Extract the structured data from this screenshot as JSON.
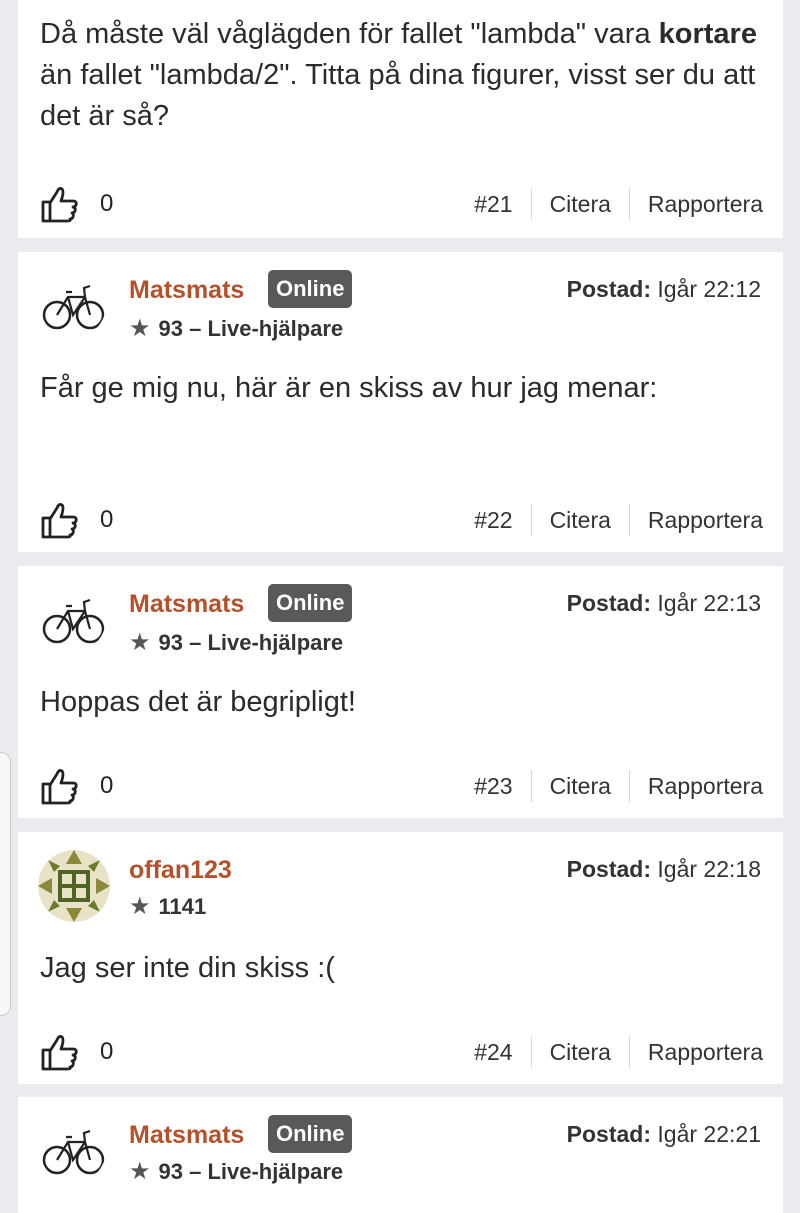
{
  "posts": [
    {
      "body_prefix": "Då måste väl våglägden för fallet \"lambda\" vara ",
      "body_bold": "kortare",
      "body_suffix": " än fallet \"lambda/2\". Titta på dina figurer, visst ser du att det är så?",
      "likes": "0",
      "number": "#21",
      "quote": "Citera",
      "report": "Rapportera"
    },
    {
      "author": "Matsmats",
      "online": "Online",
      "rank": "93 – Live-hjälpare",
      "posted_label": "Postad:",
      "posted_time": "Igår 22:12",
      "body": "Får ge mig nu, här är en skiss av hur jag menar:",
      "likes": "0",
      "number": "#22",
      "quote": "Citera",
      "report": "Rapportera"
    },
    {
      "author": "Matsmats",
      "online": "Online",
      "rank": "93 – Live-hjälpare",
      "posted_label": "Postad:",
      "posted_time": "Igår 22:13",
      "body": "Hoppas det är begripligt!",
      "likes": "0",
      "number": "#23",
      "quote": "Citera",
      "report": "Rapportera"
    },
    {
      "author": "offan123",
      "rank": "1141",
      "posted_label": "Postad:",
      "posted_time": "Igår 22:18",
      "body": "Jag ser inte din skiss :(",
      "likes": "0",
      "number": "#24",
      "quote": "Citera",
      "report": "Rapportera"
    },
    {
      "author": "Matsmats",
      "online": "Online",
      "rank": "93 – Live-hjälpare",
      "posted_label": "Postad:",
      "posted_time": "Igår 22:21"
    }
  ],
  "icons": {
    "like": "thumbs-up-icon",
    "star": "star-icon",
    "avatar_matsmats": "bicycle-avatar",
    "avatar_offan": "pattern-avatar"
  },
  "colors": {
    "username": "#b5512a",
    "badge_bg": "#58595b",
    "page_bg": "#e9ebee",
    "card_bg": "#ffffff"
  }
}
